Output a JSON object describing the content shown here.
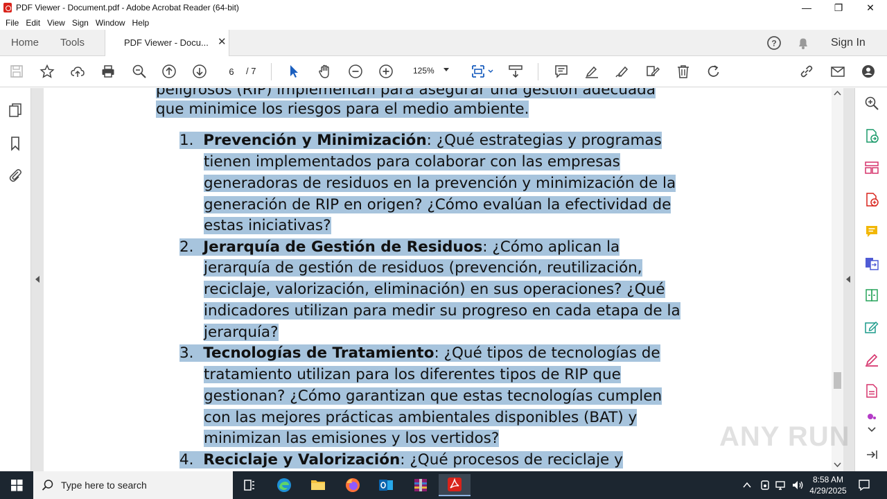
{
  "window": {
    "title": "PDF Viewer - Document.pdf - Adobe Acrobat Reader (64-bit)"
  },
  "menu": [
    "File",
    "Edit",
    "View",
    "Sign",
    "Window",
    "Help"
  ],
  "tabs": {
    "home": "Home",
    "tools": "Tools",
    "document": "PDF Viewer - Docu...",
    "sign_in": "Sign In"
  },
  "toolbar": {
    "page_current": "6",
    "page_total": "/ 7",
    "zoom": "125%"
  },
  "document": {
    "lines": [
      "peligrosos (RIP) implementan para asegurar una gestión adecuada",
      "que minimice los riesgos para el medio ambiente."
    ],
    "items": [
      {
        "num": "1.",
        "title": "Prevención y Minimización",
        "lines": [
          ": ¿Qué estrategias y programas",
          "tienen implementados para colaborar con las empresas",
          "generadoras de residuos en la prevención y minimización de la",
          "generación de RIP en origen? ¿Cómo evalúan la efectividad de",
          "estas iniciativas?"
        ]
      },
      {
        "num": "2.",
        "title": "Jerarquía de Gestión de Residuos",
        "lines": [
          ": ¿Cómo aplican la",
          "jerarquía de gestión de residuos (prevención, reutilización,",
          "reciclaje, valorización, eliminación) en sus operaciones? ¿Qué",
          "indicadores utilizan para medir su progreso en cada etapa de la",
          "jerarquía?"
        ]
      },
      {
        "num": "3.",
        "title": "Tecnologías de Tratamiento",
        "lines": [
          ": ¿Qué tipos de tecnologías de",
          "tratamiento utilizan para los diferentes tipos de RIP que",
          "gestionan? ¿Cómo garantizan que estas tecnologías cumplen",
          "con las mejores prácticas ambientales disponibles (BAT) y",
          "minimizan las emisiones y los vertidos?"
        ]
      },
      {
        "num": "4.",
        "title": "Reciclaje y Valorización",
        "lines": [
          ": ¿Qué procesos de reciclaje y"
        ]
      }
    ]
  },
  "taskbar": {
    "search_placeholder": "Type here to search",
    "time": "8:58 AM",
    "date": "4/29/2025"
  },
  "watermark": "ANY RUN",
  "colors": {
    "selection": "#a7c4dd",
    "acrobat_red": "#d9231b",
    "taskbar": "#1c2630"
  }
}
